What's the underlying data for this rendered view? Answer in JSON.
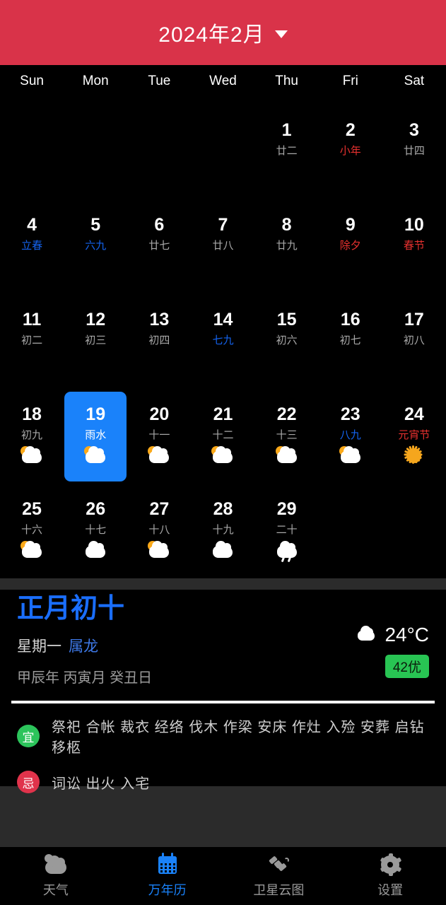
{
  "header": {
    "title": "2024年2月",
    "caret": "chevron-down-icon",
    "bg_color": "#D93349"
  },
  "calendar": {
    "weekdays": [
      "Sun",
      "Mon",
      "Tue",
      "Wed",
      "Thu",
      "Fri",
      "Sat"
    ],
    "selected_day": 19,
    "selection_color": "#1A82FA",
    "weeks": [
      [
        {
          "empty": true
        },
        {
          "empty": true
        },
        {
          "empty": true
        },
        {
          "empty": true
        },
        {
          "day": "1",
          "lunar": "廿二",
          "lunar_color": "gray",
          "weather": ""
        },
        {
          "day": "2",
          "lunar": "小年",
          "lunar_color": "red",
          "weather": ""
        },
        {
          "day": "3",
          "lunar": "廿四",
          "lunar_color": "gray",
          "weather": ""
        }
      ],
      [
        {
          "day": "4",
          "lunar": "立春",
          "lunar_color": "blue",
          "weather": ""
        },
        {
          "day": "5",
          "lunar": "六九",
          "lunar_color": "blue",
          "weather": ""
        },
        {
          "day": "6",
          "lunar": "廿七",
          "lunar_color": "gray",
          "weather": ""
        },
        {
          "day": "7",
          "lunar": "廿八",
          "lunar_color": "gray",
          "weather": ""
        },
        {
          "day": "8",
          "lunar": "廿九",
          "lunar_color": "gray",
          "weather": ""
        },
        {
          "day": "9",
          "lunar": "除夕",
          "lunar_color": "red",
          "weather": ""
        },
        {
          "day": "10",
          "lunar": "春节",
          "lunar_color": "red",
          "weather": ""
        }
      ],
      [
        {
          "day": "11",
          "lunar": "初二",
          "lunar_color": "gray",
          "weather": ""
        },
        {
          "day": "12",
          "lunar": "初三",
          "lunar_color": "gray",
          "weather": ""
        },
        {
          "day": "13",
          "lunar": "初四",
          "lunar_color": "gray",
          "weather": ""
        },
        {
          "day": "14",
          "lunar": "七九",
          "lunar_color": "blue",
          "weather": ""
        },
        {
          "day": "15",
          "lunar": "初六",
          "lunar_color": "gray",
          "weather": ""
        },
        {
          "day": "16",
          "lunar": "初七",
          "lunar_color": "gray",
          "weather": ""
        },
        {
          "day": "17",
          "lunar": "初八",
          "lunar_color": "gray",
          "weather": ""
        }
      ],
      [
        {
          "day": "18",
          "lunar": "初九",
          "lunar_color": "gray",
          "weather": "partly-cloudy"
        },
        {
          "day": "19",
          "lunar": "雨水",
          "lunar_color": "gray",
          "weather": "partly-cloudy",
          "selected": true
        },
        {
          "day": "20",
          "lunar": "十一",
          "lunar_color": "gray",
          "weather": "partly-cloudy"
        },
        {
          "day": "21",
          "lunar": "十二",
          "lunar_color": "gray",
          "weather": "partly-cloudy"
        },
        {
          "day": "22",
          "lunar": "十三",
          "lunar_color": "gray",
          "weather": "partly-cloudy"
        },
        {
          "day": "23",
          "lunar": "八九",
          "lunar_color": "blue",
          "weather": "partly-cloudy"
        },
        {
          "day": "24",
          "lunar": "元宵节",
          "lunar_color": "red",
          "weather": "sunny"
        }
      ],
      [
        {
          "day": "25",
          "lunar": "十六",
          "lunar_color": "gray",
          "weather": "partly-cloudy"
        },
        {
          "day": "26",
          "lunar": "十七",
          "lunar_color": "gray",
          "weather": "cloudy"
        },
        {
          "day": "27",
          "lunar": "十八",
          "lunar_color": "gray",
          "weather": "partly-cloudy"
        },
        {
          "day": "28",
          "lunar": "十九",
          "lunar_color": "gray",
          "weather": "cloudy"
        },
        {
          "day": "29",
          "lunar": "二十",
          "lunar_color": "gray",
          "weather": "rain"
        },
        {
          "empty": true
        },
        {
          "empty": true
        }
      ]
    ]
  },
  "detail": {
    "lunar_date": "正月初十",
    "weekday": "星期一",
    "zodiac": "属龙",
    "ganzhi": "甲辰年 丙寅月 癸丑日",
    "weather_icon": "cloud-icon",
    "temperature": "24°C",
    "aqi": "42优",
    "aqi_color": "#28C453"
  },
  "almanac": {
    "yi_badge": "宜",
    "yi_items": "祭祀 合帐 裁衣 经络 伐木 作梁 安床 作灶 入殓 安葬 启钻 移柩",
    "ji_badge": "忌",
    "ji_items": "词讼 出火 入宅"
  },
  "nav": {
    "items": [
      {
        "label": "天气",
        "icon": "weather-cloud-icon",
        "active": false
      },
      {
        "label": "万年历",
        "icon": "calendar-icon",
        "active": true
      },
      {
        "label": "卫星云图",
        "icon": "satellite-icon",
        "active": false
      },
      {
        "label": "设置",
        "icon": "gear-icon",
        "active": false
      }
    ],
    "active_color": "#1A82FA"
  }
}
